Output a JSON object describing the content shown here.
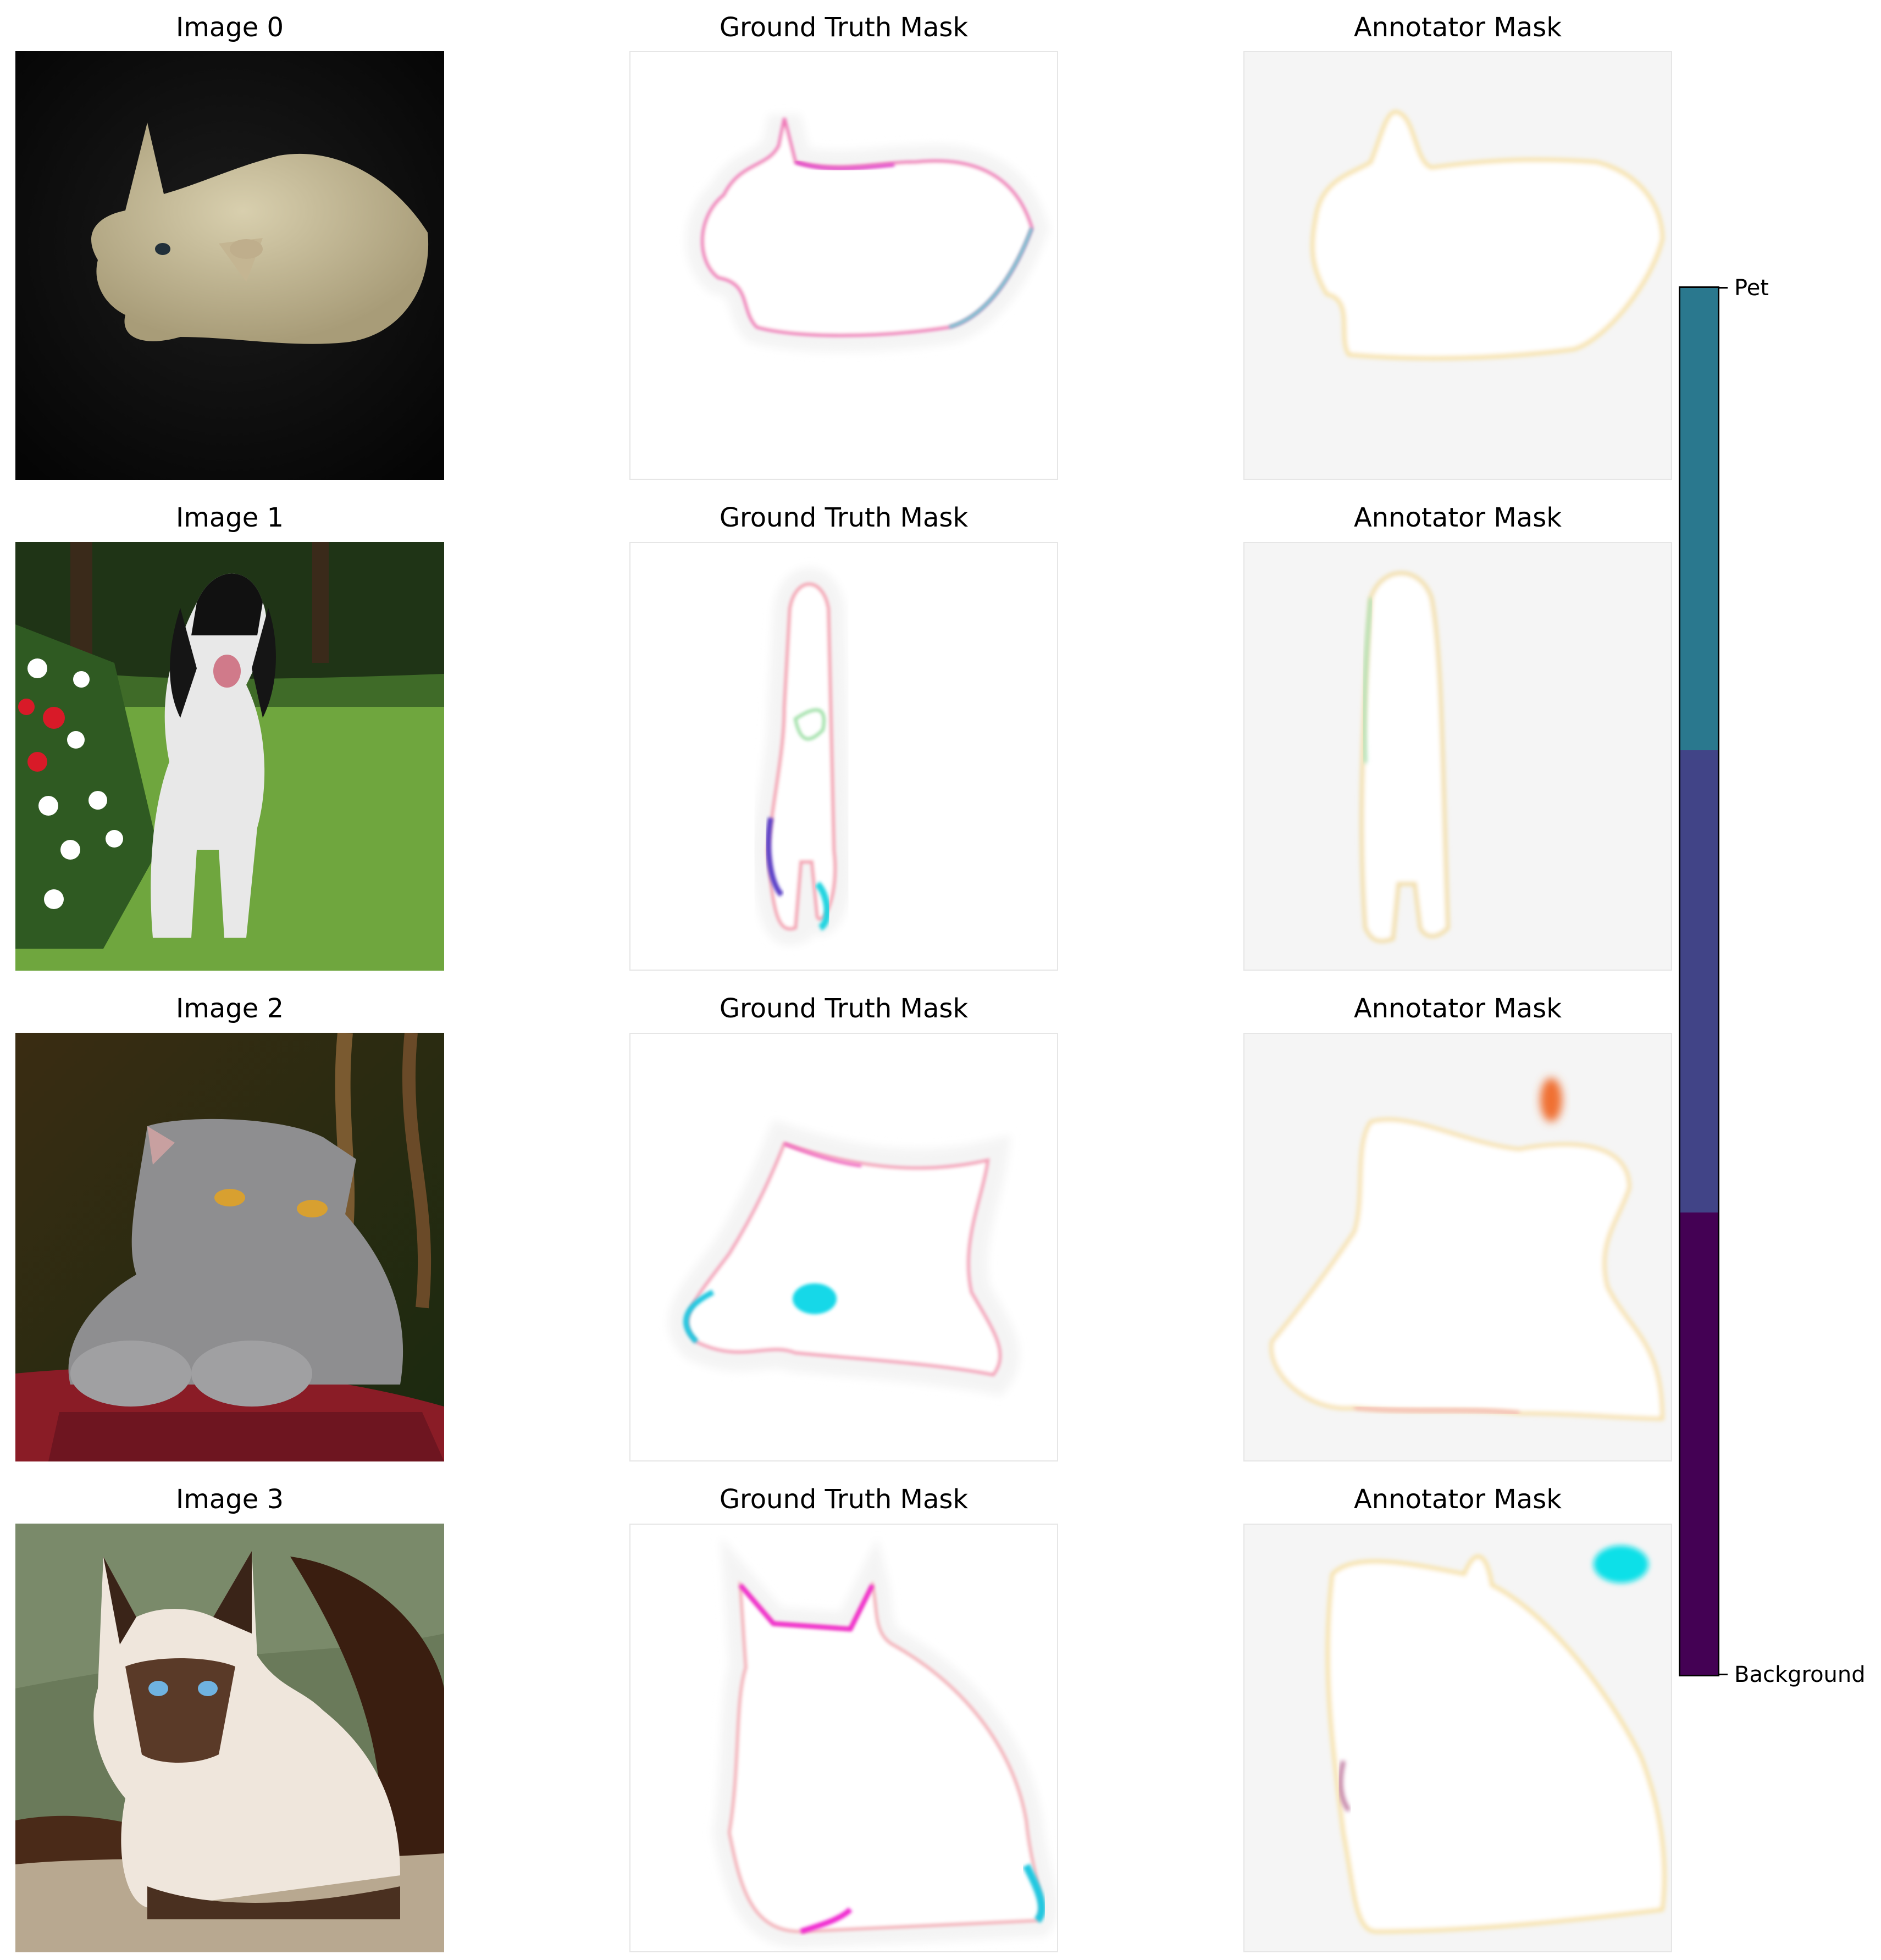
{
  "rows": [
    {
      "image_title": "Image 0",
      "gt_title": "Ground Truth Mask",
      "ann_title": "Annotator Mask",
      "subject": "sphynx-cat"
    },
    {
      "image_title": "Image 1",
      "gt_title": "Ground Truth Mask",
      "ann_title": "Annotator Mask",
      "subject": "spaniel-dog"
    },
    {
      "image_title": "Image 2",
      "gt_title": "Ground Truth Mask",
      "ann_title": "Annotator Mask",
      "subject": "gray-cat"
    },
    {
      "image_title": "Image 3",
      "gt_title": "Ground Truth Mask",
      "ann_title": "Annotator Mask",
      "subject": "siamese-cat"
    }
  ],
  "colorbar": {
    "top_label": "Pet",
    "bottom_label": "Background",
    "colors": [
      "#2a788e",
      "#414487",
      "#440154"
    ]
  }
}
